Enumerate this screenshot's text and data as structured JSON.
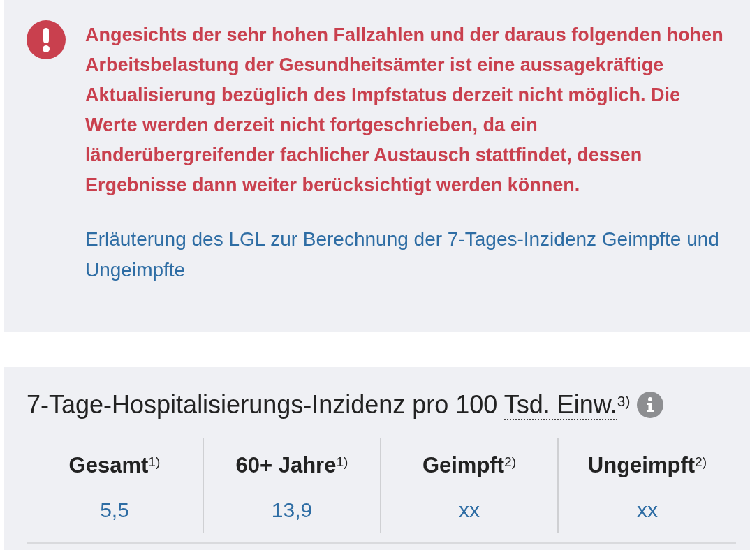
{
  "notice": {
    "message": "Angesichts der sehr hohen Fallzahlen und der daraus folgenden hohen Arbeitsbelastung der Gesundheitsämter ist eine aussagekräftige Aktualisierung bezüglich des Impfstatus derzeit nicht möglich. Die Werte werden derzeit nicht fortgeschrieben, da ein länderübergreifender fachlicher Austausch stattfindet, dessen Ergebnisse dann weiter berücksichtigt werden können.",
    "link": "Erläuterung des LGL zur Berechnung der 7-Tages-Inzidenz Geimpfte und Ungeimpfte"
  },
  "incidence": {
    "title": "7-Tage-Hospitalisierungs-Inzidenz pro 100",
    "abbreviation": "Tsd. Einw.",
    "footnote": "3)",
    "columns": [
      {
        "label": "Gesamt$^{1)}$",
        "value": "5,5"
      },
      {
        "label": "60+ Jahre$^{1)}$",
        "value": "13,9"
      },
      {
        "label": "Geimpft$^{2)}$",
        "value": "xx"
      },
      {
        "label": "Ungeimpft$^{2)}$",
        "value": "xx"
      }
    ]
  }
}
